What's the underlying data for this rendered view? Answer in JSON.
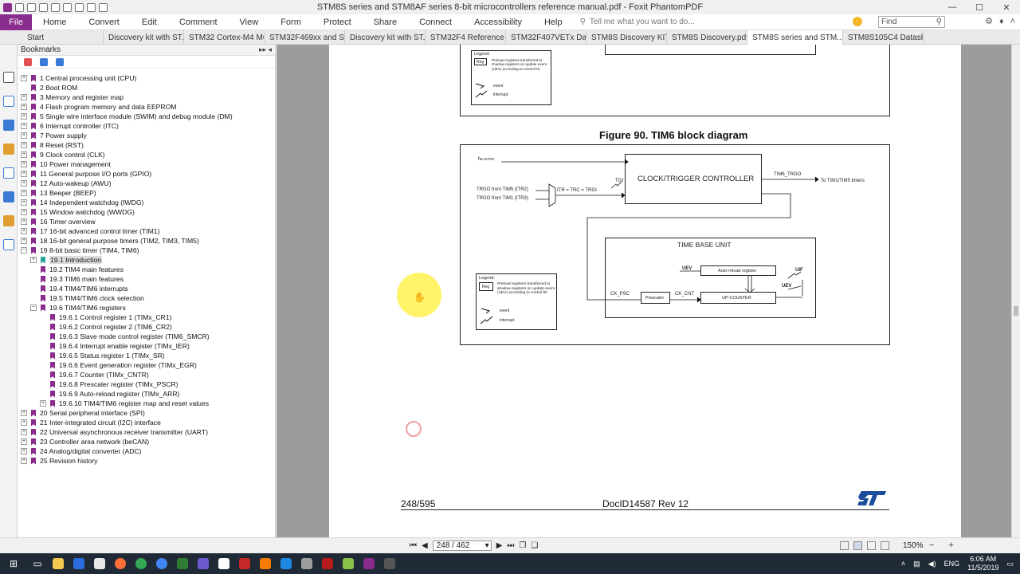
{
  "window": {
    "title": "STM8S series and STM8AF series 8-bit microcontrollers reference manual.pdf - Foxit PhantomPDF"
  },
  "menu": {
    "file": "File",
    "items": [
      "Home",
      "Convert",
      "Edit",
      "Comment",
      "View",
      "Form",
      "Protect",
      "Share",
      "Connect",
      "Accessibility",
      "Help"
    ],
    "tell_me": "Tell me what you want to do...",
    "find_placeholder": "Find"
  },
  "tabs": [
    {
      "label": "Start",
      "active": false
    },
    {
      "label": "Discovery kit with ST...",
      "active": false
    },
    {
      "label": "STM32 Cortex-M4 MC...",
      "active": false
    },
    {
      "label": "STM32F469xx and ST...",
      "active": false
    },
    {
      "label": "Discovery kit with ST...",
      "active": false
    },
    {
      "label": "STM32F4 Reference ...",
      "active": false
    },
    {
      "label": "STM32F407VETx Dat...",
      "active": false
    },
    {
      "label": "STM8S Discovery KIT ...",
      "active": false
    },
    {
      "label": "STM8S Discovery.pdf",
      "active": false
    },
    {
      "label": "STM8S series and STM...",
      "active": true
    },
    {
      "label": "STM8S105C4 Datashe...",
      "active": false
    }
  ],
  "bookmarks": {
    "title": "Bookmarks",
    "items": [
      {
        "label": "1 Central processing unit (CPU)",
        "level": 0,
        "expander": "+"
      },
      {
        "label": "2 Boot ROM",
        "level": 0,
        "expander": ""
      },
      {
        "label": "3 Memory and register map",
        "level": 0,
        "expander": "+"
      },
      {
        "label": "4 Flash program memory and data EEPROM",
        "level": 0,
        "expander": "+"
      },
      {
        "label": "5 Single wire interface module (SWIM) and debug module (DM)",
        "level": 0,
        "expander": "+"
      },
      {
        "label": "6 Interrupt controller (ITC)",
        "level": 0,
        "expander": "+"
      },
      {
        "label": "7 Power supply",
        "level": 0,
        "expander": "+"
      },
      {
        "label": "8 Reset (RST)",
        "level": 0,
        "expander": "+"
      },
      {
        "label": "9 Clock control (CLK)",
        "level": 0,
        "expander": "+"
      },
      {
        "label": "10 Power management",
        "level": 0,
        "expander": "+"
      },
      {
        "label": "11 General purpose I/O ports (GPIO)",
        "level": 0,
        "expander": "+"
      },
      {
        "label": "12 Auto-wakeup (AWU)",
        "level": 0,
        "expander": "+"
      },
      {
        "label": "13 Beeper (BEEP)",
        "level": 0,
        "expander": "+"
      },
      {
        "label": "14 Independent watchdog (IWDG)",
        "level": 0,
        "expander": "+"
      },
      {
        "label": "15 Window watchdog (WWDG)",
        "level": 0,
        "expander": "+"
      },
      {
        "label": "16 Timer overview",
        "level": 0,
        "expander": "+"
      },
      {
        "label": "17 16-bit advanced control timer (TIM1)",
        "level": 0,
        "expander": "+"
      },
      {
        "label": "18 16-bit general purpose timers (TIM2, TIM3, TIM5)",
        "level": 0,
        "expander": "+"
      },
      {
        "label": "19 8-bit basic timer (TIM4, TIM6)",
        "level": 0,
        "expander": "−"
      },
      {
        "label": "19.1 Introduction",
        "level": 1,
        "expander": "+",
        "selected": true
      },
      {
        "label": "19.2 TIM4 main features",
        "level": 1,
        "expander": ""
      },
      {
        "label": "19.3 TIM6 main features",
        "level": 1,
        "expander": ""
      },
      {
        "label": "19.4 TIM4/TIM6 interrupts",
        "level": 1,
        "expander": ""
      },
      {
        "label": "19.5 TIM4/TIM6 clock selection",
        "level": 1,
        "expander": ""
      },
      {
        "label": "19.6 TIM4/TIM6 registers",
        "level": 1,
        "expander": "−"
      },
      {
        "label": "19.6.1 Control register 1 (TIMx_CR1)",
        "level": 2,
        "expander": ""
      },
      {
        "label": "19.6.2 Control register 2 (TIM6_CR2)",
        "level": 2,
        "expander": ""
      },
      {
        "label": "19.6.3 Slave mode control register (TIM6_SMCR)",
        "level": 2,
        "expander": ""
      },
      {
        "label": "19.6.4 Interrupt enable register (TIMx_IER)",
        "level": 2,
        "expander": ""
      },
      {
        "label": "19.6.5 Status register 1 (TIMx_SR)",
        "level": 2,
        "expander": ""
      },
      {
        "label": "19.6.6 Event generation register (TIMx_EGR)",
        "level": 2,
        "expander": ""
      },
      {
        "label": "19.6.7 Counter (TIMx_CNTR)",
        "level": 2,
        "expander": ""
      },
      {
        "label": "19.6.8 Prescaler register (TIMx_PSCR)",
        "level": 2,
        "expander": ""
      },
      {
        "label": "19.6.9 Auto-reload register (TIMx_ARR)",
        "level": 2,
        "expander": ""
      },
      {
        "label": "19.6.10 TIM4/TIM6 register map and reset values",
        "level": 2,
        "expander": "+"
      },
      {
        "label": "20 Serial peripheral interface (SPI)",
        "level": 0,
        "expander": "+"
      },
      {
        "label": "21 Inter-integrated circuit (I2C) interface",
        "level": 0,
        "expander": "+"
      },
      {
        "label": "22 Universal asynchronous receiver transmitter (UART)",
        "level": 0,
        "expander": "+"
      },
      {
        "label": "23 Controller area network (beCAN)",
        "level": 0,
        "expander": "+"
      },
      {
        "label": "24 Analog/digital converter (ADC)",
        "level": 0,
        "expander": "+"
      },
      {
        "label": "25 Revision history",
        "level": 0,
        "expander": "+"
      }
    ]
  },
  "document": {
    "figure_title": "Figure 90. TIM6 block diagram",
    "legend_title": "Legend:",
    "legend_reg": "Reg",
    "legend_reg_desc": "Preload registers transferred to shadow registers on update event (UEV) according to control bit",
    "legend_event": "event",
    "legend_interrupt": "interrupt",
    "fmaster": "f",
    "fmaster_sub": "MASTER",
    "trgo_tim5": "TRGO from TIM5 (ITR2)",
    "trgo_tim1": "TRGO from TIM1 (ITR3)",
    "itr_label": "ITR = TRC = TRGI",
    "tgi": "TGI",
    "clock_trigger": "CLOCK/TRIGGER CONTROLLER",
    "tim6_trgo": "TIM6_TRGO",
    "to_timers": "To TIM1/TIM5 timers",
    "time_base_unit": "TIME BASE UNIT",
    "uev": "UEV",
    "uif": "UIF",
    "auto_reload": "Auto-reload register",
    "ck_psc": "CK_PSC",
    "prescaler": "Prescaler",
    "ck_cnt": "CK_CNT",
    "up_counter": "UP-COUNTER",
    "footer_page": "248/595",
    "footer_doc": "DocID14587 Rev 12"
  },
  "statusbar": {
    "page_field": "248 / 462",
    "zoom": "150%"
  },
  "taskbar": {
    "time": "6:06 AM",
    "date": "11/5/2019",
    "lang": "ENG"
  }
}
